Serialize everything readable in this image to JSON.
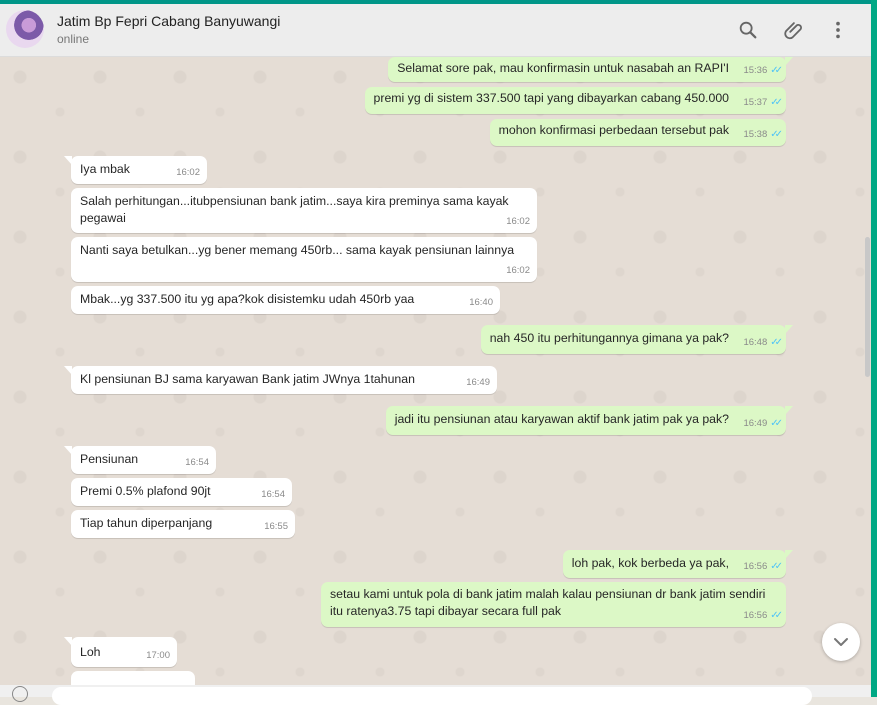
{
  "contact": {
    "name": "Jatim Bp Fepri Cabang Banyuwangi",
    "status": "online"
  },
  "header_icons": [
    "search-icon",
    "attach-icon",
    "menu-icon"
  ],
  "colors": {
    "incoming_bubble": "#ffffff",
    "outgoing_bubble": "#dcf8c6",
    "read_ticks": "#4fc3f7",
    "accent": "#009688"
  },
  "messages": [
    {
      "direction": "out",
      "text": "Selamat sore pak, mau konfirmasin untuk nasabah an RAPI'I",
      "time": "15:36",
      "ticks": "✓✓"
    },
    {
      "direction": "out",
      "text": "premi yg di sistem 337.500 tapi yang dibayarkan cabang 450.000",
      "time": "15:37",
      "ticks": "✓✓"
    },
    {
      "direction": "out",
      "text": "mohon konfirmasi perbedaan tersebut pak",
      "time": "15:38",
      "ticks": "✓✓"
    },
    {
      "direction": "in",
      "text": "Iya mbak",
      "time": "16:02"
    },
    {
      "direction": "in",
      "text": "Salah perhitungan...itubpensiunan bank jatim...saya kira preminya sama kayak pegawai",
      "time": "16:02"
    },
    {
      "direction": "in",
      "text": "Nanti saya betulkan...yg bener memang 450rb... sama kayak pensiunan lainnya",
      "time": "16:02"
    },
    {
      "direction": "in",
      "text": "Mbak...yg 337.500 itu yg apa?kok disistemku udah 450rb yaa",
      "time": "16:40"
    },
    {
      "direction": "out",
      "text": "nah 450 itu perhitungannya gimana ya pak?",
      "time": "16:48",
      "ticks": "✓✓"
    },
    {
      "direction": "in",
      "text": "Kl pensiunan BJ sama karyawan Bank jatim JWnya 1tahunan",
      "time": "16:49"
    },
    {
      "direction": "out",
      "text": "jadi itu pensiunan atau karyawan aktif bank jatim pak ya pak?",
      "time": "16:49",
      "ticks": "✓✓"
    },
    {
      "direction": "in",
      "text": "Pensiunan",
      "time": "16:54"
    },
    {
      "direction": "in",
      "text": "Premi 0.5% plafond 90jt",
      "time": "16:54"
    },
    {
      "direction": "in",
      "text": "Tiap tahun diperpanjang",
      "time": "16:55"
    },
    {
      "direction": "out",
      "text": "loh pak, kok berbeda ya pak,",
      "time": "16:56",
      "ticks": "✓✓"
    },
    {
      "direction": "out",
      "text": "setau kami untuk pola di bank jatim malah kalau pensiunan dr bank jatim sendiri itu ratenya3.75 tapi dibayar secara full pak",
      "time": "16:56",
      "ticks": "✓✓"
    },
    {
      "direction": "in",
      "text": "Loh",
      "time": "17:00"
    }
  ]
}
